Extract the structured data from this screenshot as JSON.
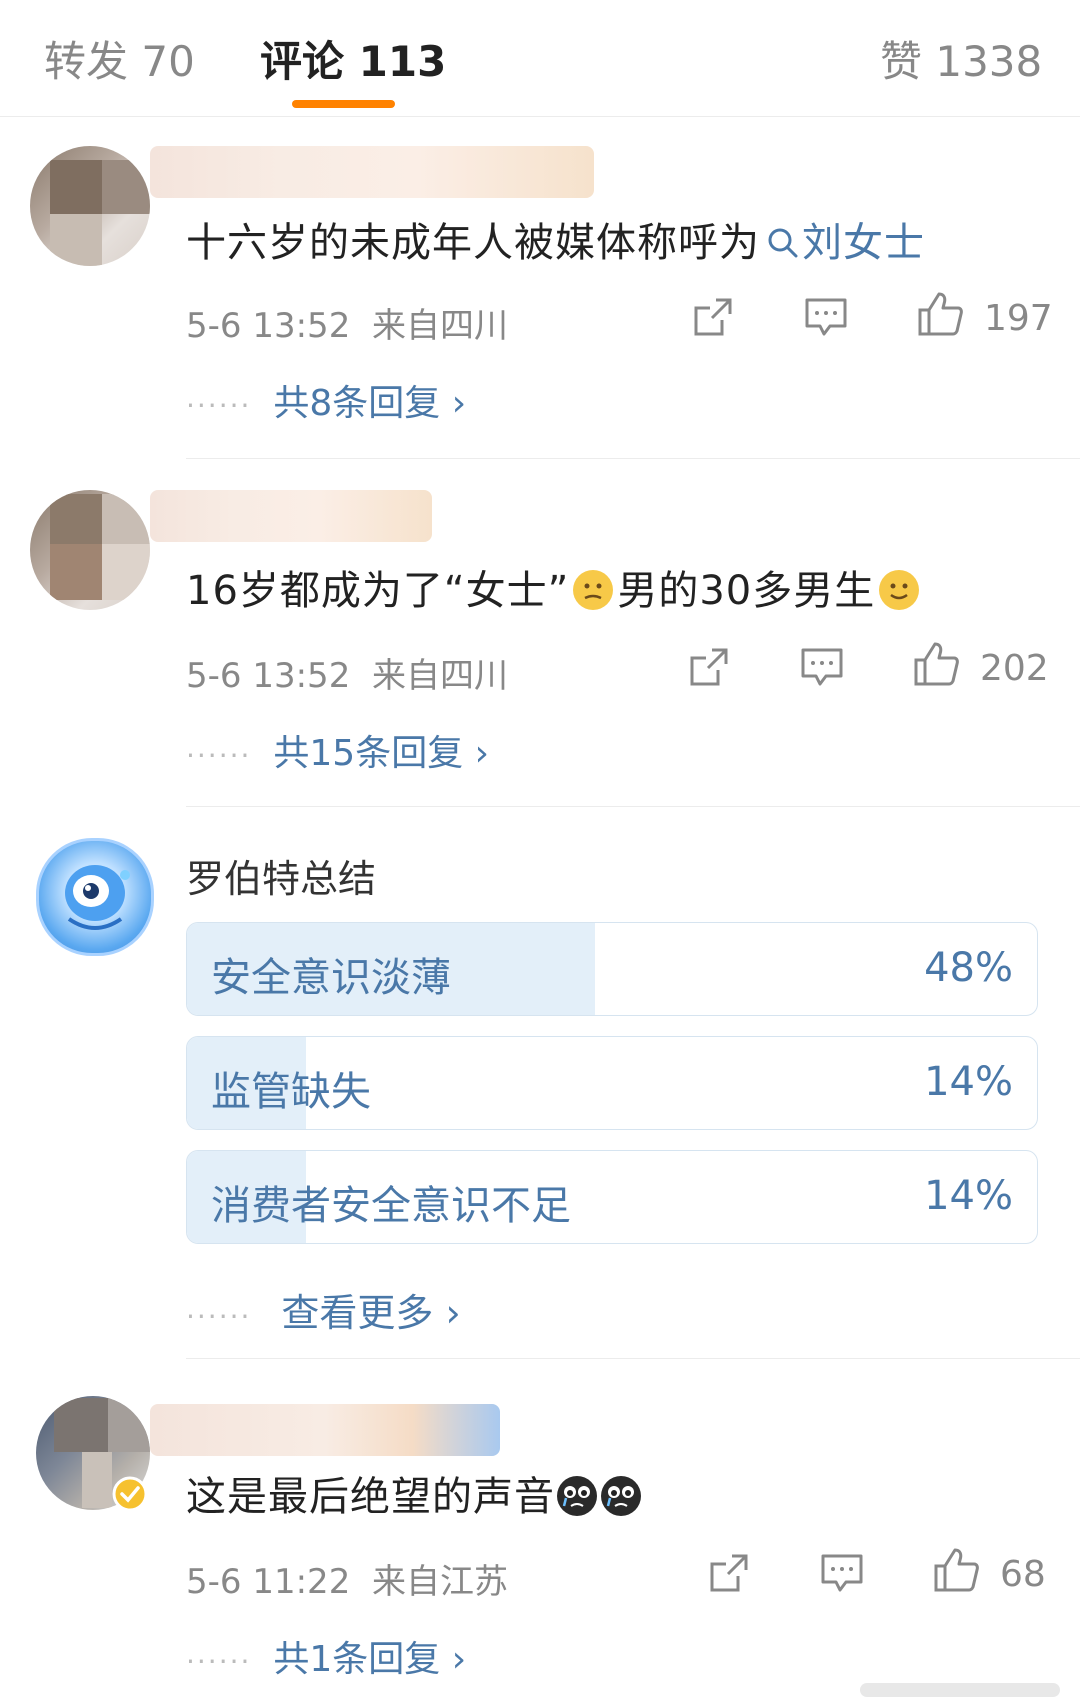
{
  "tabs": {
    "repost": "转发 70",
    "comments": "评论 113",
    "likes": "赞 1338"
  },
  "comments": [
    {
      "text_prefix": "十六岁的未成年人被媒体称呼为",
      "topic_link": "刘女士",
      "time": "5-6 13:52",
      "location": "来自四川",
      "like_count": "197",
      "replies_label": "共8条回复 ›"
    },
    {
      "text_part1": "16岁都成为了“女士”",
      "text_part2": "男的30多男生",
      "time": "5-6 13:52",
      "location": "来自四川",
      "like_count": "202",
      "replies_label": "共15条回复 ›"
    },
    {
      "text": "这是最后绝望的声音",
      "time": "5-6 11:22",
      "location": "来自江苏",
      "like_count": "68",
      "replies_label": "共1条回复 ›"
    }
  ],
  "summary": {
    "name": "罗伯特总结",
    "options": [
      {
        "label": "安全意识淡薄",
        "percent": "48%",
        "value": 48
      },
      {
        "label": "监管缺失",
        "percent": "14%",
        "value": 14
      },
      {
        "label": "消费者安全意识不足",
        "percent": "14%",
        "value": 14
      }
    ],
    "more_label": "查看更多 ›"
  },
  "dots": "······",
  "colors": {
    "accent": "#ff8200",
    "link": "#4a78a8",
    "meta": "#888888"
  },
  "icons": [
    "share-icon",
    "comment-icon",
    "like-icon",
    "search-icon",
    "emoji-icon",
    "verified-badge-icon"
  ]
}
